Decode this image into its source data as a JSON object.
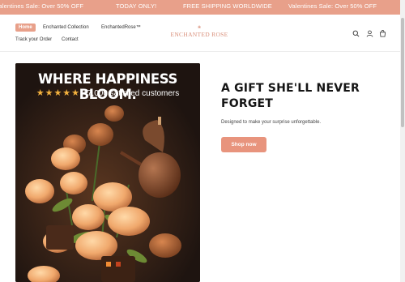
{
  "announcement": {
    "messages": [
      "Valentines Sale: Over 50% OFF",
      "TODAY ONLY!",
      "FREE SHIPPING WORLDWIDE",
      "Valentines Sale: Over 50% OFF"
    ]
  },
  "header": {
    "nav": [
      "Home",
      "Enchanted Collection",
      "EnchantedRose™",
      "Track your Order",
      "Contact"
    ],
    "logo_text": "ENCHANTED ROSE",
    "icons": [
      "search-icon",
      "account-icon",
      "cart-icon"
    ]
  },
  "hero": {
    "image_headline": "WHERE HAPPINESS BLOOM.",
    "image_stars": "★★★★★",
    "image_rating": "+7,000 satisfied customers",
    "title": "A GIFT SHE'LL NEVER FORGET",
    "subtitle": "Designed to make your surprise unforgettable.",
    "button": "Shop now"
  },
  "colors": {
    "accent": "#e8a08a",
    "button": "#e8947d",
    "text": "#141414"
  }
}
